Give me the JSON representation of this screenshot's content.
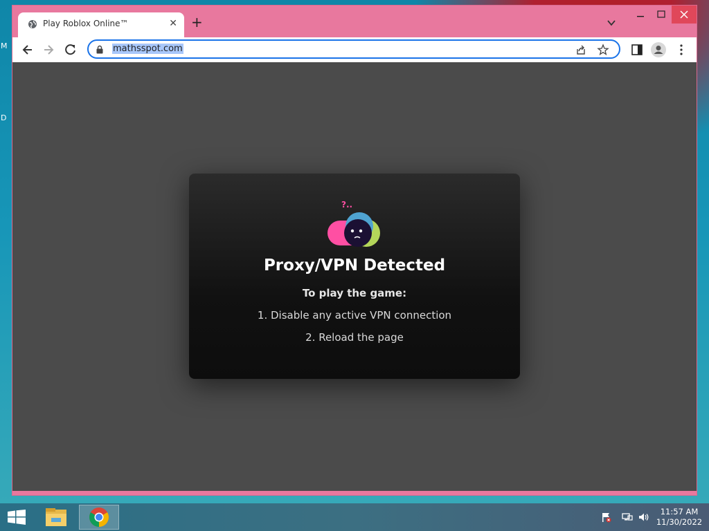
{
  "desktop": {
    "letters": [
      "M",
      "D"
    ]
  },
  "browser": {
    "tab": {
      "title": "Play Roblox Online™",
      "favicon": "globe-icon"
    },
    "address_bar": {
      "url": "mathsspot.com"
    },
    "window_controls": [
      "minimize-icon",
      "maximize-icon",
      "close-icon"
    ],
    "toolbar_icons": [
      "back-icon",
      "forward-icon",
      "reload-icon",
      "lock-icon",
      "share-icon",
      "bookmark-star-icon",
      "side-panel-icon",
      "profile-icon",
      "menu-icon"
    ]
  },
  "page": {
    "card": {
      "title": "Proxy/VPN Detected",
      "subtitle": "To play the game:",
      "steps": [
        "1. Disable any active VPN connection",
        "2. Reload the page"
      ],
      "question_mark": "?.."
    }
  },
  "taskbar": {
    "clock": {
      "time": "11:57 AM",
      "date": "11/30/2022"
    },
    "pinned": [
      "file-explorer-icon",
      "chrome-icon"
    ]
  },
  "colors": {
    "window_frame": "#e8789e",
    "page_background": "#4b4b4b",
    "card_background": "#111111",
    "accent_blue": "#1a73e8",
    "mascot_pink": "#ff4fa3",
    "mascot_blue": "#4fa3d1",
    "mascot_green": "#b4d65a"
  }
}
